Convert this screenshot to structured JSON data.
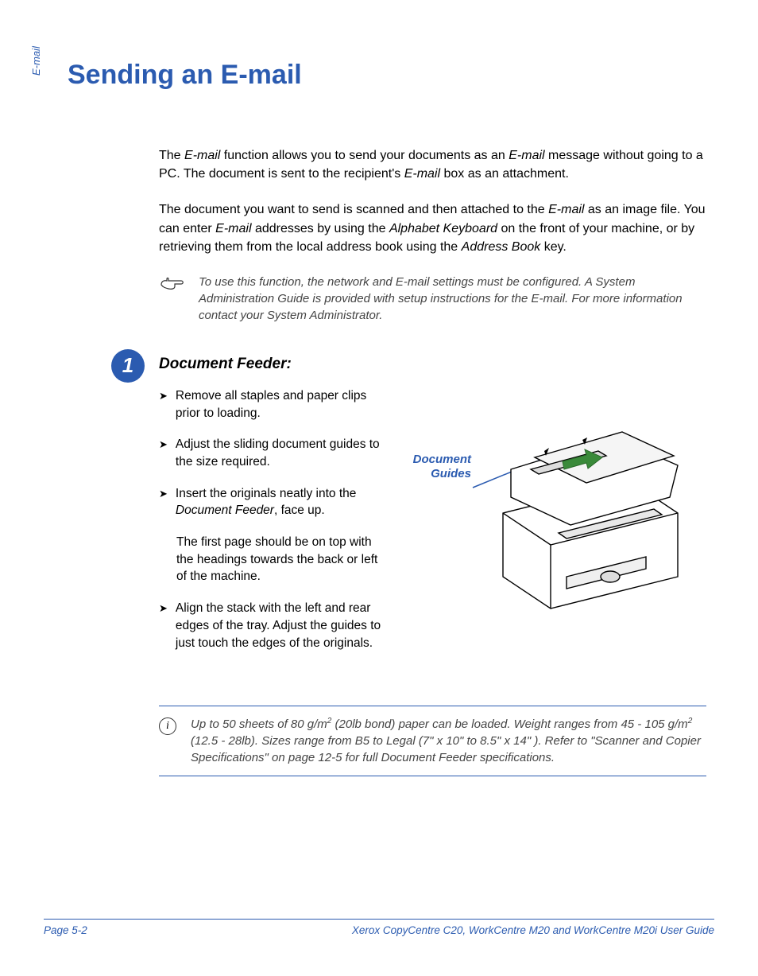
{
  "side_label": "E-mail",
  "title": "Sending an E-mail",
  "intro_p1": {
    "a": "The ",
    "b": "E-mail",
    "c": " function allows you to send your documents as an ",
    "d": "E-mail",
    "e": " message without going to a PC. The document is sent to the recipient's ",
    "f": "E-mail",
    "g": " box as an attachment."
  },
  "intro_p2": {
    "a": "The document you want to send is scanned and then attached to the ",
    "b": "E-mail",
    "c": " as an image file. You can enter ",
    "d": "E-mail",
    "e": " addresses by using the ",
    "f": "Alphabet Keyboard",
    "g": " on the front of your machine, or by retrieving them from the local address book using the ",
    "h": "Address Book",
    "i": " key."
  },
  "hand_note": "To use this function, the network and E-mail settings must be configured. A System Administration Guide is provided with setup instructions for the E-mail. For more information contact your System Administrator.",
  "step_number": "1",
  "step_heading": "Document Feeder:",
  "bullets": {
    "b1": "Remove all staples and paper clips prior to loading.",
    "b2": "Adjust the sliding document guides to the size required.",
    "b3a": "Insert the originals neatly into the ",
    "b3b": "Document Feeder",
    "b3c": ", face up.",
    "b3_sub": "The first page should be on top with the headings towards the back or left of the machine.",
    "b4": "Align the stack with the left and rear edges of the tray. Adjust the guides to just touch the edges of the originals."
  },
  "doc_guides_label": "Document Guides",
  "info_note": {
    "a": "Up to 50 sheets of 80 g/m",
    "b": " (20lb bond) paper can be loaded. Weight ranges from 45 - 105 g/m",
    "c": " (12.5 - 28lb). Sizes range from B5 to Legal (7\" x 10\" to 8.5\" x 14\" ). Refer to \"Scanner and Copier Specifications\" on page 12-5 for full Document Feeder specifications."
  },
  "footer": {
    "page": "Page 5-2",
    "guide": "Xerox CopyCentre C20, WorkCentre M20 and WorkCentre M20i User Guide"
  }
}
